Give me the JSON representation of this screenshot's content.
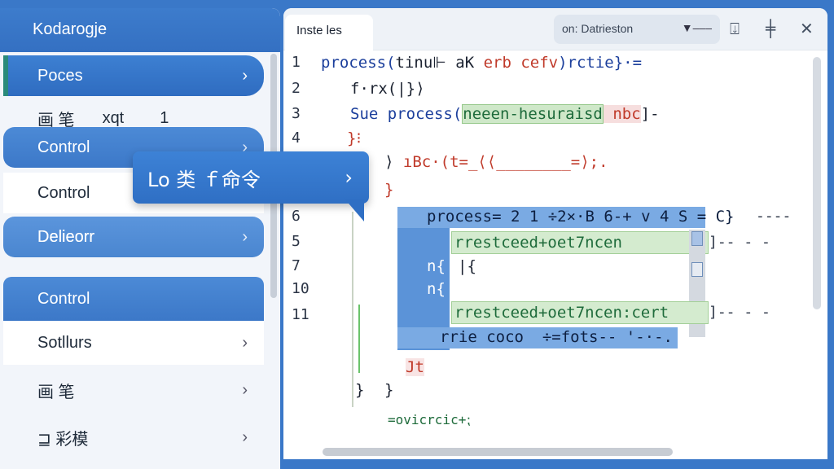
{
  "sidebar": {
    "title": "Kodarogje",
    "items": [
      {
        "label": "Poces",
        "chevron": "›"
      },
      {
        "label_a": "画 笔",
        "label_b": "xqt",
        "label_c": "1"
      },
      {
        "label": "Control",
        "chevron": "›"
      },
      {
        "label": "Control"
      },
      {
        "label": "Delieorr",
        "chevron": "›"
      },
      {
        "label": "Control"
      },
      {
        "label": "Sotllurs",
        "chevron": "›"
      },
      {
        "label": "画 笔",
        "chevron": "›"
      },
      {
        "label": "⊒ 彩模",
        "chevron": "›"
      }
    ]
  },
  "popup": {
    "label": "Lo 类 ｆ命令",
    "chevron": "›"
  },
  "editor": {
    "tab_label": "Inste les",
    "search": {
      "value": "on: Datrieston",
      "dropdown": "▼–––"
    },
    "toolbar_icons": [
      "download-icon",
      "pin-icon",
      "close-icon"
    ],
    "toolbar_glyphs": [
      "⍗",
      "╪",
      "✕"
    ],
    "line_numbers": [
      "1",
      "2",
      "3",
      "4",
      "6",
      "5",
      "7",
      "10",
      "11"
    ],
    "lines": {
      "l1_a": "process(",
      "l1_b": "tinu⊩ aK ",
      "l1_c": "erb cefv",
      "l1_d": ")rctie}·=",
      "l2": "f·rx(|}⟩",
      "l3_a": "Sue process(",
      "l3_b": "neeen-hesuraisd",
      "l3_c": " nbc",
      "l3_d": "]-",
      "l4": "}⁝",
      "l5_a": "⟩ ",
      "l5_b": "ıBc·(t=_⟨⟨________=⟩;.",
      "l6": "}",
      "sel_1": "process= 2 1 ÷2×·B 6-+ v 4 S = C}",
      "sel_1_tail": "----",
      "green_1": "rrestceed+oet7ncen",
      "green_1_tail": "]-- - -",
      "brace_a": "n{",
      "brace_b": "|{",
      "brace_c": "n{",
      "green_2": "rrestceed+oet7ncen:cert",
      "green_2_tail": "]-- - -",
      "sel_last": "rrie coco  ÷=fots-- '-·-.",
      "jt": "Jt",
      "close_1": "}",
      "close_2": "}",
      "last": "=ovicrcic+⁏"
    }
  }
}
